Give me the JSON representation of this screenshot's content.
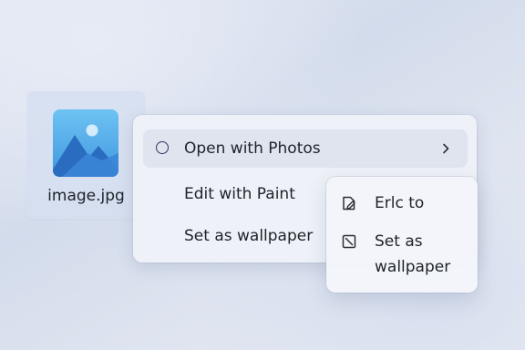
{
  "file": {
    "name": "image.jpg",
    "thumbnail_icon": "image-thumbnail-icon",
    "colors": {
      "sky": "#5fb6ef",
      "mountain_back": "#2a6fc2",
      "mountain_front": "#3a86d4",
      "sun": "#cbe7fb"
    }
  },
  "context_menu": {
    "items": [
      {
        "label": "Open with Photos",
        "icon": "radio-circle-icon",
        "has_submenu": true
      },
      {
        "label": "Edit with Paint"
      },
      {
        "label": "Set as wallpaper"
      }
    ]
  },
  "submenu": {
    "items": [
      {
        "label": "Erlc to",
        "icon": "doc-edit-icon"
      },
      {
        "label": "Set as wallpaper",
        "icon": "wallpaper-icon"
      }
    ]
  }
}
